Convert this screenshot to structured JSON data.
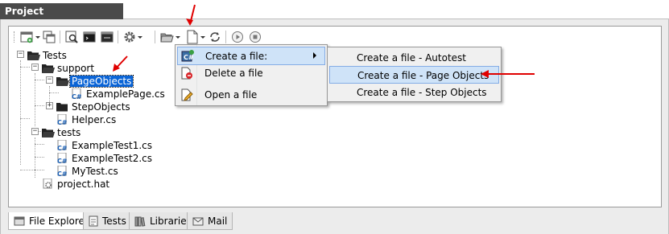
{
  "window": {
    "title": "Project"
  },
  "tree": {
    "root": "Tests",
    "support": "support",
    "page_objects": "PageObjects",
    "example_page": "ExamplePage.cs",
    "step_objects": "StepObjects",
    "helper": "Helper.cs",
    "tests": "tests",
    "example_test1": "ExampleTest1.cs",
    "example_test2": "ExampleTest2.cs",
    "my_test": "MyTest.cs",
    "project_hat": "project.hat"
  },
  "context_menu": {
    "create": "Create a file:",
    "delete": "Delete a file",
    "open": "Open a file"
  },
  "submenu": {
    "autotest": "Create a file - Autotest",
    "page_objects": "Create a file - Page Objects",
    "step_objects": "Create a file - Step Objects"
  },
  "bottom_tabs": {
    "file_explorer": "File Explorer",
    "tests": "Tests",
    "libraries": "Libraries",
    "mail": "Mail"
  },
  "colors": {
    "title_bar": "#4a4a4a",
    "selection": "#0a64d6",
    "menu_hover": "#cfe3f8",
    "annotation": "#e00000"
  }
}
